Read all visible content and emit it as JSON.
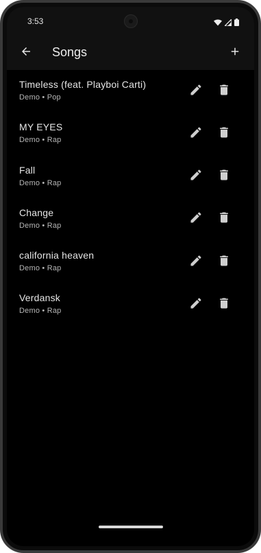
{
  "status_bar": {
    "time": "3:53",
    "icons": [
      "wifi-icon",
      "signal-icon",
      "battery-icon"
    ]
  },
  "app_bar": {
    "title": "Songs",
    "back_icon": "arrow-back-icon",
    "add_icon": "add-icon"
  },
  "songs": [
    {
      "title": "Timeless (feat. Playboi Carti)",
      "meta": "Demo • Pop"
    },
    {
      "title": "MY EYES",
      "meta": "Demo • Rap"
    },
    {
      "title": "Fall",
      "meta": "Demo • Rap"
    },
    {
      "title": "Change",
      "meta": "Demo • Rap"
    },
    {
      "title": "california heaven",
      "meta": "Demo • Rap"
    },
    {
      "title": "Verdansk",
      "meta": "Demo • Rap"
    }
  ],
  "row_icons": {
    "edit": "pencil-icon",
    "delete": "trash-icon"
  },
  "colors": {
    "background": "#000000",
    "app_bar": "#111111",
    "text_primary": "#e6e6e6",
    "text_secondary": "#b5b5b5",
    "icon": "#cfcfcf"
  }
}
